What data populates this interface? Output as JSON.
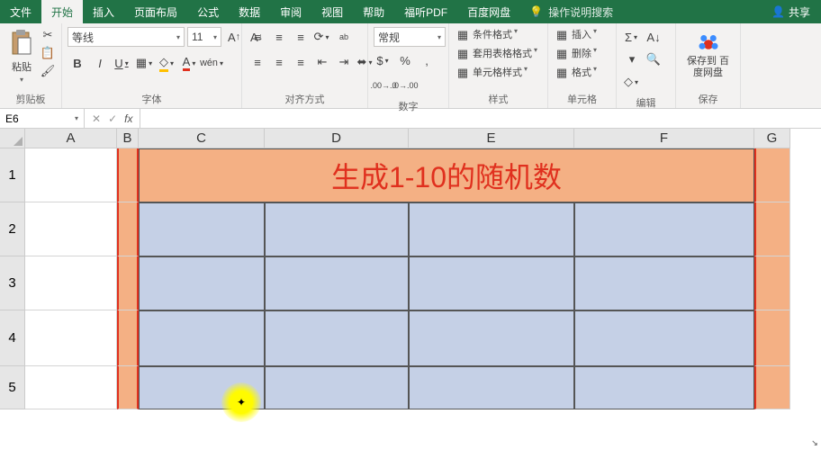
{
  "tabs": {
    "file": "文件",
    "home": "开始",
    "insert": "插入",
    "layout": "页面布局",
    "formulas": "公式",
    "data": "数据",
    "review": "审阅",
    "view": "视图",
    "help": "帮助",
    "foxit": "福听PDF",
    "baidu": "百度网盘",
    "tell_me": "操作说明搜索",
    "share": "共享"
  },
  "ribbon": {
    "clipboard": {
      "paste": "粘贴",
      "label": "剪贴板"
    },
    "font": {
      "name": "等线",
      "size": "11",
      "bold": "B",
      "italic": "I",
      "underline": "U",
      "label": "字体"
    },
    "alignment": {
      "wrap": "ab",
      "label": "对齐方式"
    },
    "number": {
      "format": "常规",
      "label": "数字"
    },
    "styles": {
      "conditional": "条件格式",
      "table": "套用表格格式",
      "cell": "单元格样式",
      "label": "样式"
    },
    "cells": {
      "insert": "插入",
      "delete": "删除",
      "format": "格式",
      "label": "单元格"
    },
    "editing": {
      "label": "编辑"
    },
    "save": {
      "btn": "保存到\n百度网盘",
      "label": "保存"
    }
  },
  "name_box": "E6",
  "fx": "fx",
  "columns": {
    "A": "A",
    "B": "B",
    "C": "C",
    "D": "D",
    "E": "E",
    "F": "F",
    "G": "G"
  },
  "rows": {
    "1": "1",
    "2": "2",
    "3": "3",
    "4": "4",
    "5": "5"
  },
  "merged_title": "生成1-10的随机数"
}
